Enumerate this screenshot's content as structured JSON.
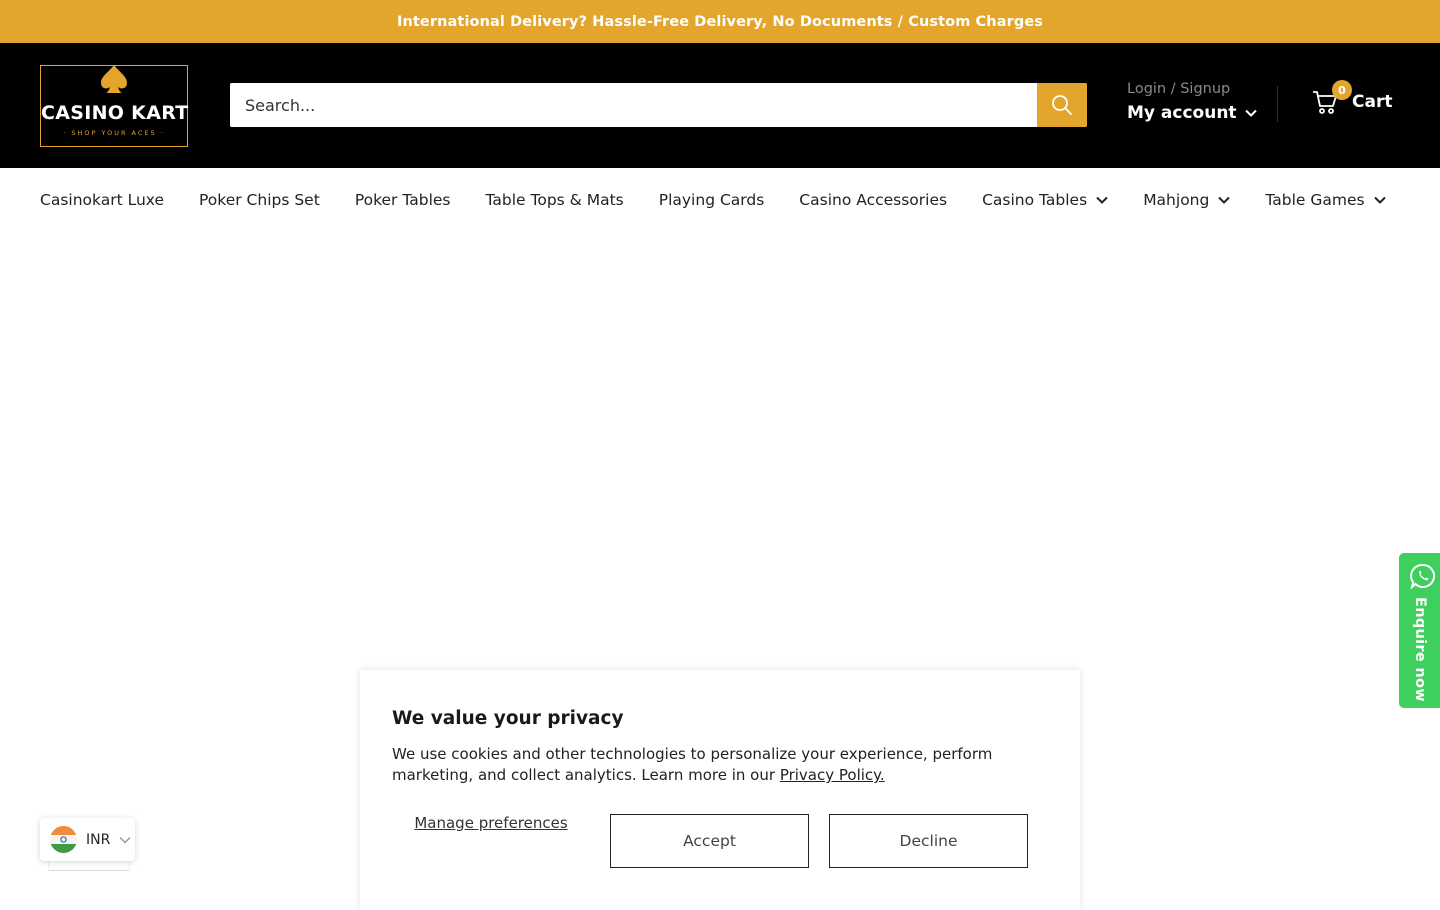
{
  "announcement": "International Delivery? Hassle-Free Delivery, No Documents / Custom Charges",
  "logo": {
    "name": "CASINO KART",
    "tagline": "· SHOP YOUR ACES ·"
  },
  "search": {
    "placeholder": "Search..."
  },
  "account": {
    "login_label": "Login / Signup",
    "account_label": "My account"
  },
  "cart": {
    "label": "Cart",
    "count": "0"
  },
  "nav": [
    {
      "label": "Casinokart Luxe",
      "dropdown": false
    },
    {
      "label": "Poker Chips Set",
      "dropdown": false
    },
    {
      "label": "Poker Tables",
      "dropdown": false
    },
    {
      "label": "Table Tops & Mats",
      "dropdown": false
    },
    {
      "label": "Playing Cards",
      "dropdown": false
    },
    {
      "label": "Casino Accessories",
      "dropdown": false
    },
    {
      "label": "Casino Tables",
      "dropdown": true
    },
    {
      "label": "Mahjong",
      "dropdown": true
    },
    {
      "label": "Table Games",
      "dropdown": true
    }
  ],
  "enquire": {
    "label": "Enquire now"
  },
  "currency": {
    "code": "INR"
  },
  "privacy": {
    "title": "We value your privacy",
    "body": "We use cookies and other technologies to personalize your experience, perform marketing, and collect analytics. Learn more in our",
    "link": "Privacy Policy.",
    "manage_label": "Manage preferences",
    "accept_label": "Accept",
    "decline_label": "Decline"
  },
  "colors": {
    "accent": "#e3a52c",
    "header_bg": "#000000",
    "whatsapp": "#3fcf5e"
  },
  "icons": {
    "search": "search-icon",
    "cart": "cart-icon",
    "chevron": "chevron-down-icon",
    "flag": "india-flag-icon",
    "whatsapp": "whatsapp-icon",
    "logo": "spade-icon"
  }
}
